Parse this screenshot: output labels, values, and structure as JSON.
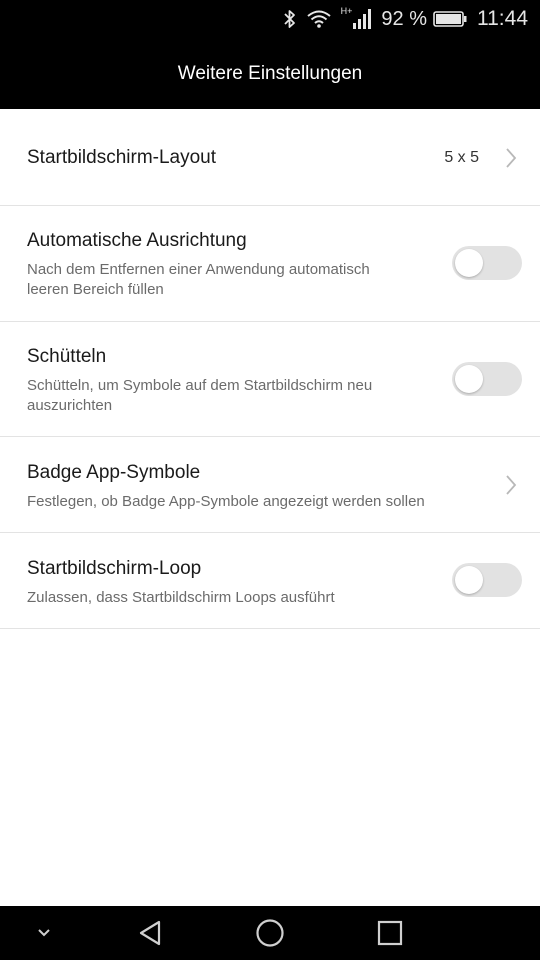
{
  "status_bar": {
    "network_type": "H+",
    "battery_percent": "92 %",
    "time": "11:44",
    "icons": [
      "bluetooth-icon",
      "wifi-icon",
      "signal-icon",
      "battery-icon"
    ]
  },
  "header": {
    "title": "Weitere Einstellungen"
  },
  "settings": [
    {
      "title": "Startbildschirm-Layout",
      "value": "5 x 5",
      "control": "chevron"
    },
    {
      "title": "Automatische Ausrichtung",
      "subtitle_line1": "Nach dem Entfernen einer Anwendung automatisch",
      "subtitle_line2": "leeren Bereich füllen",
      "control": "toggle",
      "enabled": false
    },
    {
      "title": "Schütteln",
      "subtitle_line1": "Schütteln, um Symbole auf dem Startbildschirm neu",
      "subtitle_line2": "auszurichten",
      "control": "toggle",
      "enabled": false
    },
    {
      "title": "Badge App-Symbole",
      "subtitle_line1": "Festlegen, ob Badge App-Symbole angezeigt werden sollen",
      "control": "chevron"
    },
    {
      "title": "Startbildschirm-Loop",
      "subtitle_line1": "Zulassen, dass Startbildschirm Loops ausführt",
      "control": "toggle",
      "enabled": false
    }
  ],
  "nav_bar": {
    "buttons": [
      "chevron-down-icon",
      "back-icon",
      "home-icon",
      "recents-icon"
    ]
  },
  "colors": {
    "header_bg": "#000000",
    "toggle_off": "#e2e2e2",
    "divider": "#e3e3e3"
  }
}
